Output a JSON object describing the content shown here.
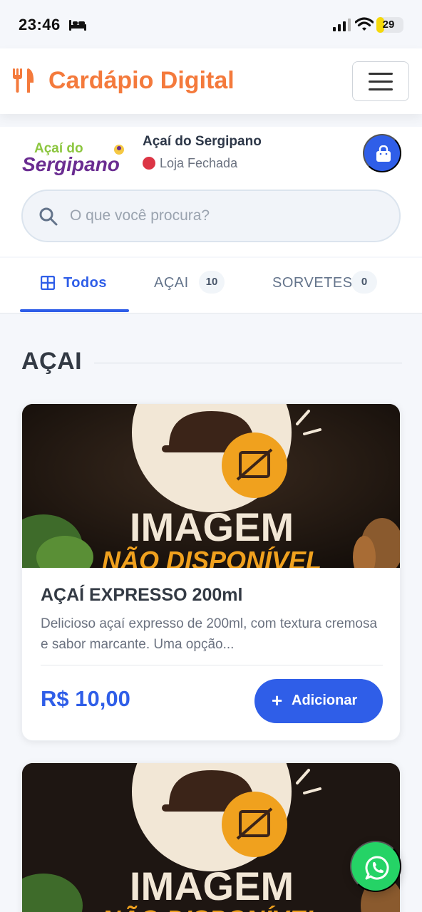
{
  "status_bar": {
    "time": "23:46",
    "battery": "29",
    "battery_level": 0.29,
    "icons": [
      "bed-icon",
      "signal-icon",
      "wifi-icon",
      "battery-icon"
    ]
  },
  "header": {
    "brand": "Cardápio Digital",
    "brand_color": "#f47a3c",
    "icons": [
      "fork-knife-icon",
      "menu-icon"
    ]
  },
  "store": {
    "logo_text": [
      "Açaí do",
      "Sergipano"
    ],
    "name": "Açaí do Sergipano",
    "status": "Loja Fechada",
    "status_color": "#dc3545",
    "cart_icon": "shopping-bag-icon"
  },
  "search": {
    "placeholder": "O que você procura?",
    "value": ""
  },
  "tabs": [
    {
      "label": "Todos",
      "icon": "grid-icon",
      "active": true
    },
    {
      "label": "AÇAI",
      "count": "10",
      "active": false
    },
    {
      "label": "SORVETES",
      "count": "0",
      "active": false
    }
  ],
  "section": {
    "title": "AÇAI"
  },
  "placeholder_image": {
    "line1": "IMAGEM",
    "line2": "NÃO DISPONÍVEL"
  },
  "products": [
    {
      "name": "AÇAÍ EXPRESSO 200ml",
      "description": "Delicioso açaí expresso de 200ml, com textura cremosa e sabor marcante. Uma opção...",
      "price": "R$ 10,00",
      "add_label": "Adicionar"
    }
  ],
  "colors": {
    "accent": "#2f5ee8",
    "whatsapp": "#25d366"
  },
  "floating": {
    "icon": "whatsapp-icon"
  }
}
